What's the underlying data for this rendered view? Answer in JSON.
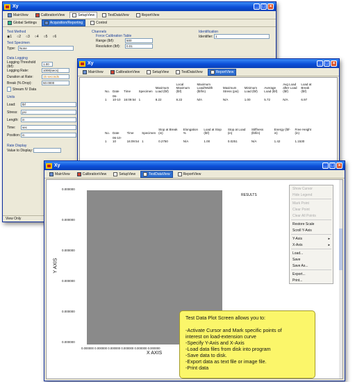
{
  "app_title": "Xy",
  "tabs_main": [
    "MainView",
    "CalibrationView",
    "SetupView",
    "TestDataView",
    "ReportView"
  ],
  "win1": {
    "subtabs": [
      "Global Settings",
      "Acquisition/Reporting",
      "Control"
    ],
    "test_method": {
      "label": "Test Method",
      "options": [
        "1",
        "2",
        "3",
        "4",
        "5",
        "6"
      ]
    },
    "test_specimen": {
      "label": "Test Specimen",
      "type_label": "Type:",
      "type_value": "None"
    },
    "channels": {
      "label": "Channels",
      "calib": "Force Calibration Table",
      "range_label": "Range (lbf):",
      "range_value": "500",
      "res_label": "Resolution (lbf):",
      "res_value": "0.01"
    },
    "identification": {
      "label": "Identification",
      "id_label": "Identifier:",
      "id_value": "1"
    },
    "data_logging": {
      "label": "Data Logging",
      "rows": [
        {
          "label": "Logging Threshold (lbf):",
          "value": "1.00"
        },
        {
          "label": "Logging Rate:",
          "value": "1000(secs)"
        },
        {
          "label": "Duration at Rate:",
          "value": "15 seconds"
        },
        {
          "label": "Break (% Drop):",
          "value": "50.0000"
        }
      ],
      "stream": "Stream IV Data"
    },
    "units": {
      "label": "Units",
      "rows": [
        {
          "label": "Load:",
          "value": "lbf"
        },
        {
          "label": "Stress:",
          "value": "psi"
        },
        {
          "label": "Length:",
          "value": "in"
        },
        {
          "label": "Time:",
          "value": "sec"
        },
        {
          "label": "Position:",
          "value": "in"
        }
      ]
    },
    "rate_display": {
      "label": "Rate Display",
      "value_label": "Value to Display:"
    },
    "status": "View Only"
  },
  "win2": {
    "table1": {
      "headers": [
        "No.",
        "Date",
        "Time",
        "Specimen",
        "Maximum Load (lbf)",
        "Local Maximum (lbf)",
        "Maximum Load/Width (lbf/in)",
        "Maximum Stress (psi)",
        "Minimum Load (lbf)",
        "Average Load (lbf)",
        "Avg Load after Load (lbf)",
        "Load at Break (lbf)"
      ],
      "rows": [
        [
          "1",
          "06-10-10",
          "16:09:54",
          "1",
          "8.22",
          "8.22",
          "N/A",
          "N/A",
          "1.00",
          "5.72",
          "N/A",
          "6.97"
        ]
      ]
    },
    "table2": {
      "headers": [
        "No.",
        "Date",
        "Time",
        "Specimen",
        "Stop at Break (in)",
        "Elongation %",
        "Load at Stop (lbf)",
        "Stop at Load (in)",
        "Stiffness (lbf/in)",
        "Energy (lbf-in)",
        "Free Height (in)"
      ],
      "rows": [
        [
          "1",
          "06-10-10",
          "16:09:54",
          "1",
          "0.2750",
          "N/A",
          "1.00",
          "0.0251",
          "N/A",
          "1.42",
          "1.1530"
        ]
      ]
    }
  },
  "win3": {
    "results_label": "RESULTS",
    "y_axis": "Y AXIS",
    "x_axis": "X AXIS",
    "y_ticks": [
      "0.000000",
      "0.000000",
      "0.000000",
      "0.000000",
      "0.000000",
      "0.000000"
    ],
    "x_ticks": "0.000000 0.000000 0.000000 0.000000 0.000000 0.000000",
    "menu": [
      {
        "label": "Show Cursor",
        "enabled": false
      },
      {
        "label": "Hide Legend",
        "enabled": false
      },
      {
        "sep": true
      },
      {
        "label": "Mark Point",
        "enabled": false
      },
      {
        "label": "Clear Point",
        "enabled": false
      },
      {
        "label": "Clear All Points",
        "enabled": false
      },
      {
        "sep": true
      },
      {
        "label": "Restore Scale",
        "enabled": true
      },
      {
        "label": "Scroll Y-Axis",
        "enabled": true
      },
      {
        "sep": true
      },
      {
        "label": "Y-Axis",
        "enabled": true,
        "arrow": "▸"
      },
      {
        "label": "X-Axis",
        "enabled": true,
        "arrow": "▸"
      },
      {
        "sep": true
      },
      {
        "label": "Load...",
        "enabled": true
      },
      {
        "label": "Save",
        "enabled": true
      },
      {
        "label": "Save As...",
        "enabled": true
      },
      {
        "sep": true
      },
      {
        "label": "Export...",
        "enabled": true
      },
      {
        "label": "Print...",
        "enabled": true
      }
    ]
  },
  "note_lines": [
    "Test Data Plot Screen allows you to:",
    "",
    "-Activate Cursor and Mark specific points of",
    "interest on load-extension curve",
    "-Specify Y-Axis and X-Axis",
    "-Load data files from disk into program",
    "-Save data to disk.",
    "-Export data as text file  or image file.",
    "-Print data"
  ],
  "colors": {
    "titlebar": "#0c4fd8",
    "plot": "#8a8a8a",
    "note": "#fbf66a"
  }
}
